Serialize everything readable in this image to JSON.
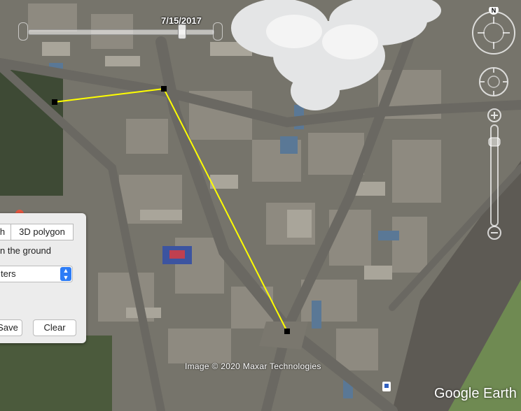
{
  "timeline": {
    "date": "7/15/2017"
  },
  "compass": {
    "north_label": "N"
  },
  "measure_panel": {
    "tabs": [
      {
        "label": "h"
      },
      {
        "label": "3D polygon"
      }
    ],
    "clamp_label": "n the ground",
    "units": {
      "selected": "ters"
    },
    "buttons": {
      "save": "Save",
      "clear": "Clear"
    }
  },
  "attribution": {
    "copyright": "Image © 2020 Maxar Technologies",
    "logo": "Google Earth"
  },
  "measurement": {
    "line_color": "#ffff00",
    "vertex_color": "#000000"
  }
}
